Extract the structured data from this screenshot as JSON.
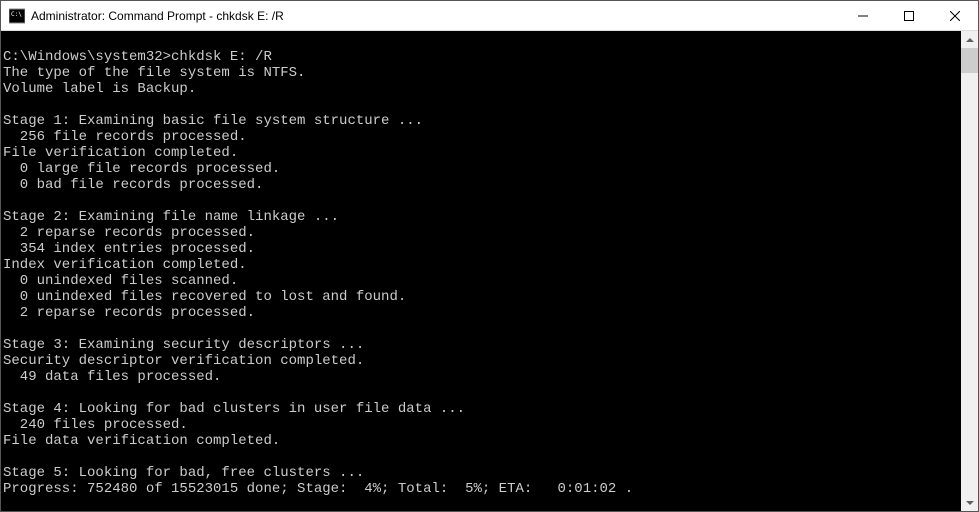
{
  "window": {
    "title": "Administrator: Command Prompt - chkdsk  E: /R"
  },
  "console": {
    "blank": "",
    "prompt_line": "C:\\Windows\\system32>chkdsk E: /R",
    "lines": [
      "The type of the file system is NTFS.",
      "Volume label is Backup.",
      "",
      "Stage 1: Examining basic file system structure ...",
      "  256 file records processed.",
      "File verification completed.",
      "  0 large file records processed.",
      "  0 bad file records processed.",
      "",
      "Stage 2: Examining file name linkage ...",
      "  2 reparse records processed.",
      "  354 index entries processed.",
      "Index verification completed.",
      "  0 unindexed files scanned.",
      "  0 unindexed files recovered to lost and found.",
      "  2 reparse records processed.",
      "",
      "Stage 3: Examining security descriptors ...",
      "Security descriptor verification completed.",
      "  49 data files processed.",
      "",
      "Stage 4: Looking for bad clusters in user file data ...",
      "  240 files processed.",
      "File data verification completed.",
      "",
      "Stage 5: Looking for bad, free clusters ...",
      "Progress: 752480 of 15523015 done; Stage:  4%; Total:  5%; ETA:   0:01:02 ."
    ]
  }
}
